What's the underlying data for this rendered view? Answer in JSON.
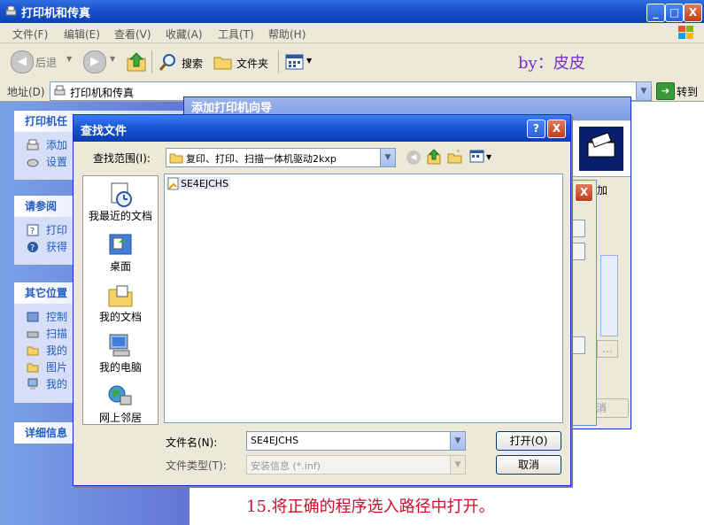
{
  "main_window": {
    "title": "打印机和传真",
    "min_label": "_",
    "max_label": "□",
    "close_label": "X"
  },
  "menu": [
    "文件(F)",
    "编辑(E)",
    "查看(V)",
    "收藏(A)",
    "工具(T)",
    "帮助(H)"
  ],
  "toolbar": {
    "back_label": "后退",
    "search_label": "搜索",
    "folders_label": "文件夹",
    "byline": "by：皮皮"
  },
  "address": {
    "label": "地址(D)",
    "value": "打印机和传真",
    "go_label": "转到"
  },
  "taskpane": {
    "printer_tasks": {
      "title": "打印机任",
      "items": [
        "添加",
        "设置"
      ]
    },
    "see_also": {
      "title": "请参阅",
      "items": [
        "打印",
        "获得"
      ]
    },
    "other_places": {
      "title": "其它位置",
      "items": [
        "控制",
        "扫描",
        "我的",
        "图片",
        "我的"
      ]
    },
    "details": {
      "title": "详细信息"
    }
  },
  "wizard": {
    "title": "添加打印机向导",
    "text_fragment": "加",
    "cancel_label": "取消",
    "ellipsis": "..."
  },
  "find_dialog": {
    "title": "查找文件",
    "help_label": "?",
    "close_label": "X",
    "look_in_label": "查找范围(I):",
    "look_in_value": "复印、打印、扫描一体机驱动2kxp",
    "places": [
      "我最近的文档",
      "桌面",
      "我的文档",
      "我的电脑",
      "网上邻居"
    ],
    "files": [
      "SE4EJCHS"
    ],
    "filename_label": "文件名(N):",
    "filename_value": "SE4EJCHS",
    "filetype_label": "文件类型(T):",
    "filetype_value": "安装信息 (*.inf)",
    "open_label": "打开(O)",
    "cancel_label": "取消"
  },
  "caption": "15.将正确的程序选入路径中打开。"
}
